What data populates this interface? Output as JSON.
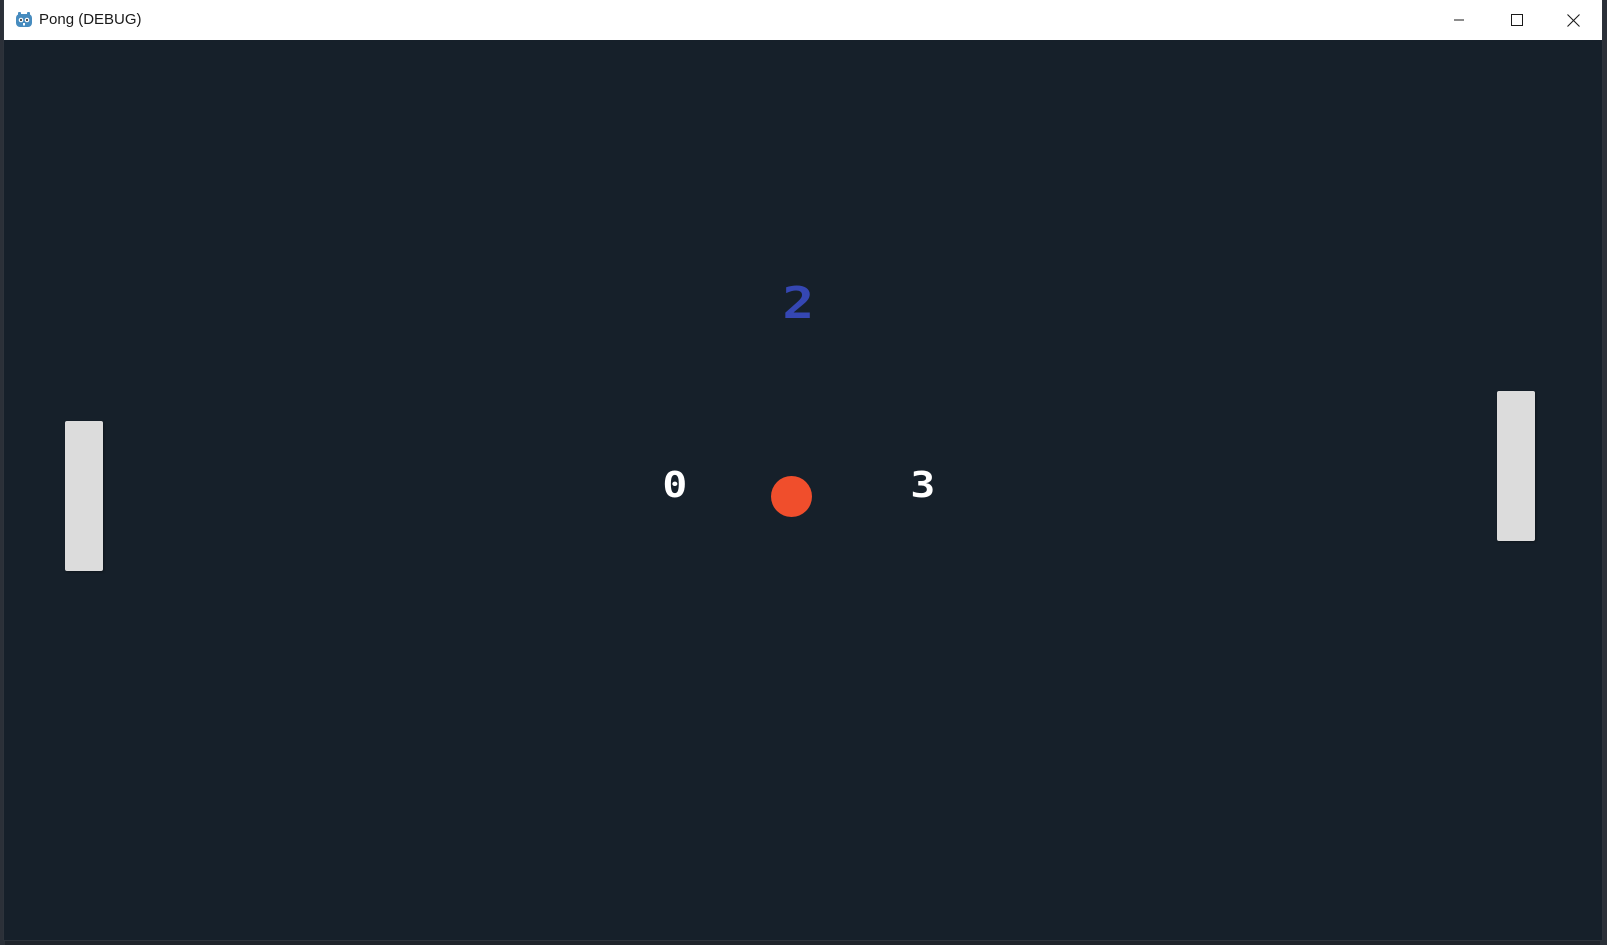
{
  "window": {
    "title": "Pong (DEBUG)",
    "icon": "godot-engine-icon",
    "controls": {
      "minimize_icon": "minimize-icon",
      "maximize_icon": "maximize-icon",
      "close_icon": "close-icon"
    }
  },
  "game": {
    "background_color": "#16202a",
    "countdown": "2",
    "countdown_color": "#3547b3",
    "score_left": "0",
    "score_right": "3",
    "ball_color": "#f04e2c",
    "paddle_color": "#dcdcdc"
  }
}
